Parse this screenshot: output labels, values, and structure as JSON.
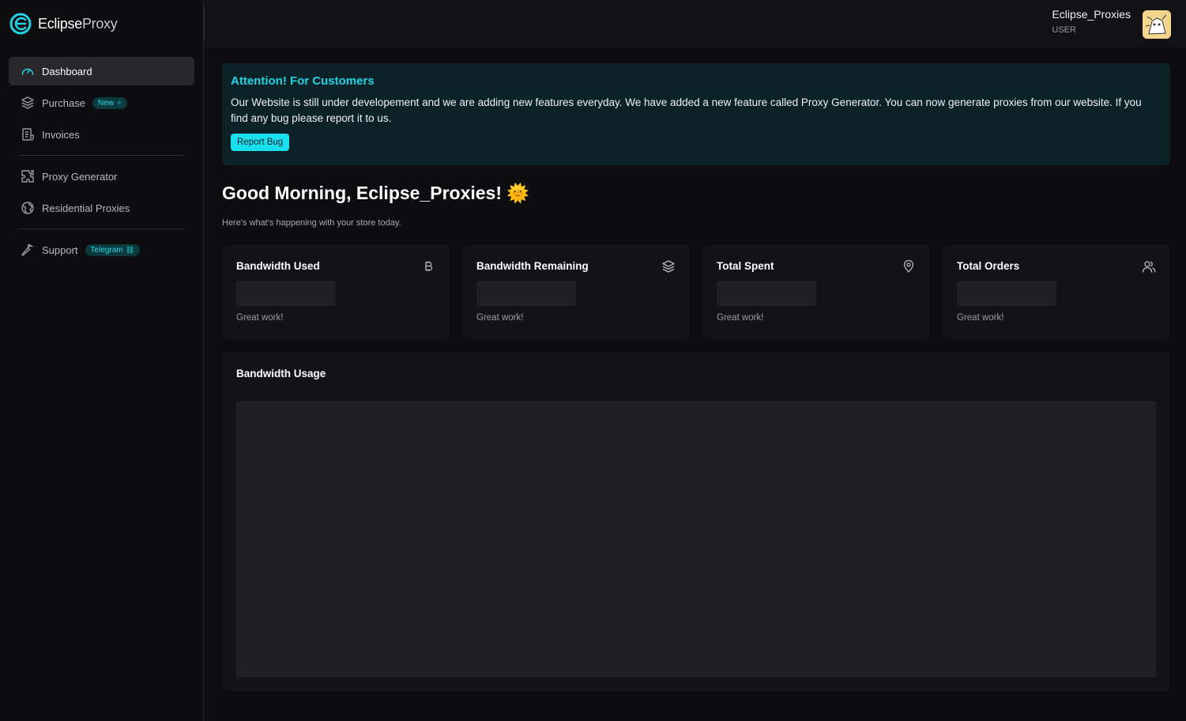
{
  "brand": {
    "name_bold": "Eclipse",
    "name_thin": "Proxy"
  },
  "sidebar": {
    "items": [
      {
        "label": "Dashboard",
        "icon": "gauge-icon"
      },
      {
        "label": "Purchase",
        "icon": "layers-icon",
        "badge": "New"
      },
      {
        "label": "Invoices",
        "icon": "receipt-icon"
      },
      {
        "label": "Proxy Generator",
        "icon": "puzzle-icon"
      },
      {
        "label": "Residential Proxies",
        "icon": "globe-icon"
      },
      {
        "label": "Support",
        "icon": "wrench-icon",
        "badge": "Telegram"
      }
    ]
  },
  "header": {
    "user_name": "Eclipse_Proxies",
    "user_role": "USER"
  },
  "alert": {
    "title": "Attention! For Customers",
    "text": "Our Website is still under developement and we are adding new features everyday. We have added a new feature called Proxy Generator. You can now generate proxies from our website. If you find any bug please report it to us.",
    "button": "Report Bug"
  },
  "greeting": {
    "title": "Good Morning, Eclipse_Proxies!",
    "emoji": "🌞",
    "subtitle": "Here's what's happening with your store today."
  },
  "cards": [
    {
      "title": "Bandwidth Used",
      "icon": "bitcoin-icon",
      "footer": "Great work!"
    },
    {
      "title": "Bandwidth Remaining",
      "icon": "layers-icon",
      "footer": "Great work!"
    },
    {
      "title": "Total Spent",
      "icon": "map-pin-icon",
      "footer": "Great work!"
    },
    {
      "title": "Total Orders",
      "icon": "users-icon",
      "footer": "Great work!"
    }
  ],
  "usage": {
    "title": "Bandwidth Usage"
  },
  "colors": {
    "accent": "#1fd3e6",
    "background": "#0d0d10",
    "card": "#131317"
  }
}
